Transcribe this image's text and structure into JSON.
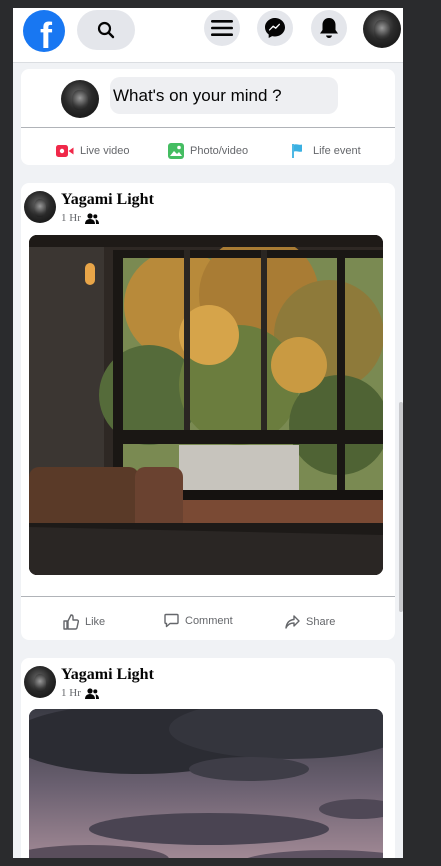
{
  "topbar": {
    "logo_letter": "f",
    "icons": [
      "search-icon",
      "menu-icon",
      "messenger-icon",
      "bell-icon"
    ]
  },
  "composer": {
    "placeholder": "What's on your mind ?",
    "actions": [
      {
        "label": "Live video",
        "icon": "live-video-icon",
        "color": "#f02849"
      },
      {
        "label": "Photo/video",
        "icon": "photo-icon",
        "color": "#45bd62"
      },
      {
        "label": "Life event",
        "icon": "flag-icon",
        "color": "#3ab0e2"
      }
    ]
  },
  "posts": [
    {
      "author": "Yagami Light",
      "time": "1 Hr",
      "privacy_icon": "friends-icon"
    },
    {
      "author": "Yagami Light",
      "time": "1 Hr",
      "privacy_icon": "friends-icon"
    }
  ],
  "post_actions": {
    "like": "Like",
    "comment": "Comment",
    "share": "Share"
  },
  "colors": {
    "brand": "#1877f2",
    "background": "#f0f2f5",
    "card": "#ffffff"
  }
}
